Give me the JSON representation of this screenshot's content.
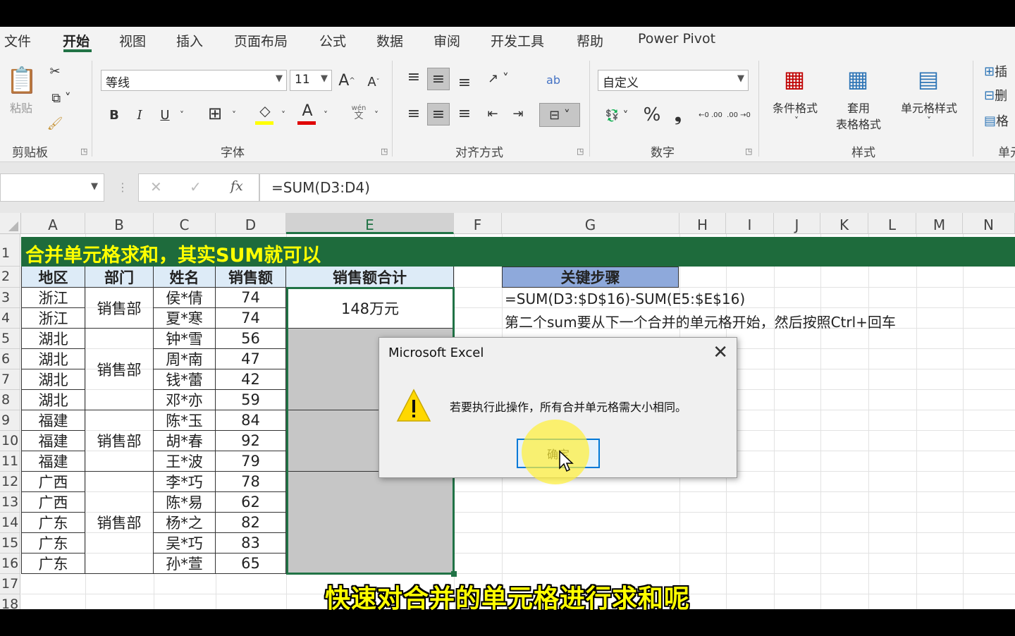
{
  "ribbon": {
    "tabs": [
      "文件",
      "开始",
      "视图",
      "插入",
      "页面布局",
      "公式",
      "数据",
      "审阅",
      "开发工具",
      "帮助",
      "Power Pivot"
    ],
    "active_tab": "开始",
    "clipboard": {
      "paste_label": "粘贴",
      "group": "剪贴板"
    },
    "font": {
      "name": "等线",
      "size": "11",
      "group": "字体",
      "grow": "A",
      "shrink": "A",
      "bold": "B",
      "italic": "I",
      "underline": "U",
      "color_letter": "A",
      "phonetic_top": "wén",
      "phonetic_bottom": "文"
    },
    "alignment": {
      "group": "对齐方式",
      "wrap": "ab"
    },
    "number": {
      "format": "自定义",
      "group": "数字",
      "percent": "%",
      "comma": "❟",
      "inc_decimal": "←0 .00",
      "dec_decimal": ".00 →0"
    },
    "styles": {
      "group": "样式",
      "conditional": "条件格式",
      "table_line1": "套用",
      "table_line2": "表格格式",
      "cell_styles": "单元格样式"
    },
    "cells": {
      "group": "单元",
      "insert": "插",
      "delete": "删",
      "format": "格"
    }
  },
  "formula_bar": {
    "name_box": "",
    "formula": "=SUM(D3:D4)",
    "cancel": "✕",
    "enter": "✓",
    "fx": "fx"
  },
  "sheet": {
    "columns": [
      "A",
      "B",
      "C",
      "D",
      "E",
      "F",
      "G",
      "H",
      "I",
      "J",
      "K",
      "L",
      "M",
      "N"
    ],
    "rows": [
      "1",
      "2",
      "3",
      "4",
      "5",
      "6",
      "7",
      "8",
      "9",
      "10",
      "11",
      "12",
      "13",
      "14",
      "15",
      "16",
      "17",
      "18"
    ],
    "title": "合并单元格求和，其实SUM就可以",
    "headers": {
      "region": "地区",
      "dept": "部门",
      "name": "姓名",
      "sales": "销售额",
      "total": "销售额合计",
      "steps": "关键步骤"
    },
    "data": [
      {
        "region": "浙江",
        "name": "侯*倩",
        "sales": "74"
      },
      {
        "region": "浙江",
        "name": "夏*寒",
        "sales": "74"
      },
      {
        "region": "湖北",
        "name": "钟*雪",
        "sales": "56"
      },
      {
        "region": "湖北",
        "name": "周*南",
        "sales": "47"
      },
      {
        "region": "湖北",
        "name": "钱*蕾",
        "sales": "42"
      },
      {
        "region": "湖北",
        "name": "邓*亦",
        "sales": "59"
      },
      {
        "region": "福建",
        "name": "陈*玉",
        "sales": "84"
      },
      {
        "region": "福建",
        "name": "胡*春",
        "sales": "92"
      },
      {
        "region": "福建",
        "name": "王*波",
        "sales": "79"
      },
      {
        "region": "广西",
        "name": "李*巧",
        "sales": "78"
      },
      {
        "region": "广西",
        "name": "陈*易",
        "sales": "62"
      },
      {
        "region": "广东",
        "name": "杨*之",
        "sales": "82"
      },
      {
        "region": "广东",
        "name": "吴*巧",
        "sales": "83"
      },
      {
        "region": "广东",
        "name": "孙*萱",
        "sales": "65"
      }
    ],
    "dept_groups": [
      "销售部",
      "销售部",
      "销售部",
      "销售部"
    ],
    "total_first": "148万元",
    "notes": [
      "=SUM(D3:$D$16)-SUM(E5:$E$16)",
      "第二个sum要从下一个合并的单元格开始，然后按照Ctrl+回车"
    ]
  },
  "dialog": {
    "title": "Microsoft Excel",
    "message": "若要执行此操作，所有合并单元格需大小相同。",
    "ok": "确定",
    "close": "✕"
  },
  "subtitle": "快速对合并的单元格进行求和呢",
  "colors": {
    "excel_green": "#217346",
    "title_bg": "#1e6b3c",
    "title_text": "#ffff00",
    "header_fill": "#ddebf7",
    "steps_fill": "#8ea9db"
  }
}
